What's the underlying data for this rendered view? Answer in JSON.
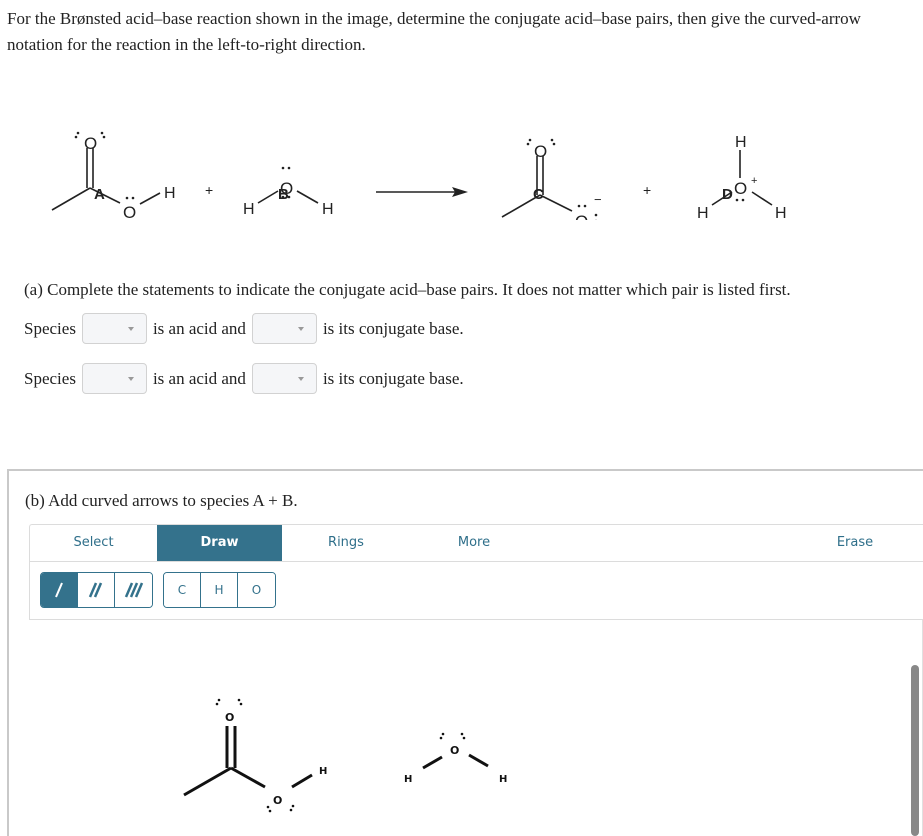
{
  "intro": "For the Brønsted acid–base reaction shown in the image, determine the conjugate acid–base pairs, then give the curved-arrow notation for the reaction in the left-to-right direction.",
  "reaction": {
    "plus": "+",
    "species": [
      {
        "label": "A",
        "name": "acetic acid"
      },
      {
        "label": "B",
        "name": "water"
      },
      {
        "label": "C",
        "name": "acetate"
      },
      {
        "label": "D",
        "name": "hydronium"
      }
    ],
    "atoms": {
      "O": "O",
      "H": "H"
    },
    "charges": {
      "minus": "−",
      "plus": "+"
    }
  },
  "partA": {
    "prompt": "(a) Complete the statements to indicate the conjugate acid–base pairs. It does not matter which pair is listed first.",
    "rows": [
      {
        "species": "Species",
        "acid_text": "is an acid and",
        "base_text": "is its conjugate base.",
        "acid_value": "",
        "base_value": ""
      },
      {
        "species": "Species",
        "acid_text": "is an acid and",
        "base_text": "is its conjugate base.",
        "acid_value": "",
        "base_value": ""
      }
    ]
  },
  "partB": {
    "prompt": "(b) Add curved arrows to species A + B.",
    "tabs": [
      {
        "label": "Select",
        "active": false
      },
      {
        "label": "Draw",
        "active": true
      },
      {
        "label": "Rings",
        "active": false
      },
      {
        "label": "More",
        "active": false
      },
      {
        "label": "Erase",
        "active": false
      }
    ],
    "bond_tools": [
      {
        "name": "single-bond",
        "glyph": "/",
        "active": true
      },
      {
        "name": "double-bond",
        "glyph": "//",
        "active": false
      },
      {
        "name": "triple-bond",
        "glyph": "///",
        "active": false
      }
    ],
    "atom_tools": [
      "C",
      "H",
      "O"
    ],
    "canvas_atoms": {
      "O": "O",
      "H": "H"
    }
  },
  "colors": {
    "accent": "#34728c",
    "tab_text": "#2f6f8a"
  }
}
